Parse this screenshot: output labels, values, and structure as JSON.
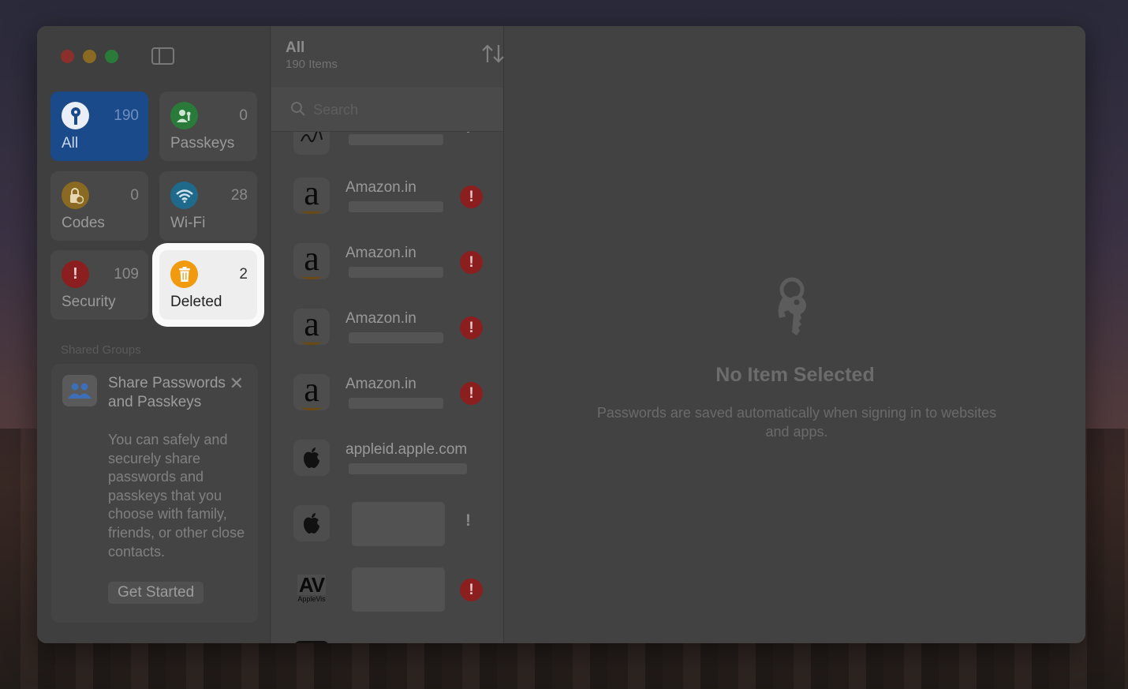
{
  "sidebar": {
    "tiles": [
      {
        "label": "All",
        "count": "190",
        "color": "#1a4a8a"
      },
      {
        "label": "Passkeys",
        "count": "0",
        "color": "#2a7a3a"
      },
      {
        "label": "Codes",
        "count": "0",
        "color": "#8a6a22"
      },
      {
        "label": "Wi-Fi",
        "count": "28",
        "color": "#1f6a8a"
      },
      {
        "label": "Security",
        "count": "109",
        "color": "#8b1f1f"
      },
      {
        "label": "Deleted",
        "count": "2",
        "color": "#f29a0e"
      }
    ],
    "section_heading": "Shared Groups",
    "share_card": {
      "title": "Share Passwords and Passkeys",
      "body": "You can safely and securely share passwords and passkeys that you choose with family, friends, or other close contacts.",
      "button": "Get Started"
    }
  },
  "list": {
    "title": "All",
    "subtitle": "190 Items",
    "search_placeholder": "Search",
    "rows": [
      {
        "title": "Amazon.in",
        "logo": "amazon-logo",
        "warning": true
      },
      {
        "title": "Amazon.in",
        "logo": "amazon-logo",
        "warning": true
      },
      {
        "title": "Amazon.in",
        "logo": "amazon-logo",
        "warning": true
      },
      {
        "title": "Amazon.in",
        "logo": "amazon-logo",
        "warning": true
      },
      {
        "title": "appleid.apple.com",
        "logo": "apple-logo",
        "warning": false
      },
      {
        "title": "",
        "logo": "apple-logo",
        "warning": false
      },
      {
        "title": "",
        "logo": "applevis-logo",
        "warning": true
      }
    ],
    "applevis_logo_text": "AV",
    "applevis_logo_sub": "AppleVis"
  },
  "detail": {
    "title": "No Item Selected",
    "subtitle": "Passwords are saved automatically when signing in to websites and apps."
  }
}
